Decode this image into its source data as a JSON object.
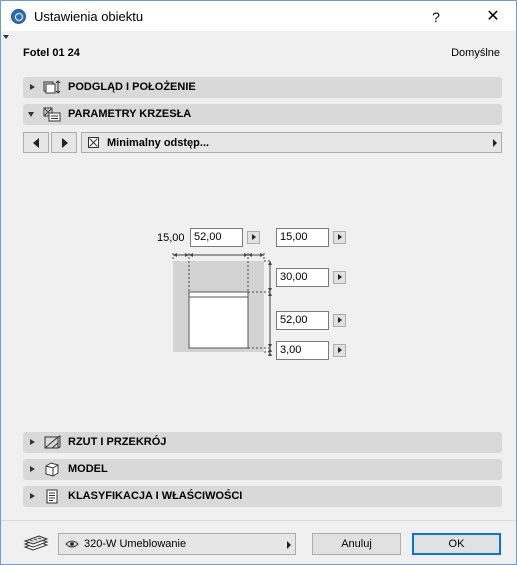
{
  "window": {
    "title": "Ustawienia obiektu",
    "help_label": "?",
    "close_label": "✕"
  },
  "header": {
    "object_name": "Fotel 01 24",
    "default_label": "Domyślne"
  },
  "sections": {
    "preview": {
      "label": "PODGLĄD I POŁOŻENIE",
      "icon": "preview-position-icon",
      "expanded": false
    },
    "chair_params": {
      "label": "PARAMETRY KRZESŁA",
      "icon": "chair-parameters-icon",
      "expanded": true
    },
    "plan_section": {
      "label": "RZUT I PRZEKRÓJ",
      "icon": "plan-section-icon",
      "expanded": false
    },
    "model": {
      "label": "MODEL",
      "icon": "model-cube-icon",
      "expanded": false
    },
    "classification": {
      "label": "KLASYFIKACJA I WŁAŚCIWOŚCI",
      "icon": "classification-icon",
      "expanded": false
    }
  },
  "param_nav": {
    "page_label": "Minimalny odstęp..."
  },
  "clearance": {
    "left_offset": "15,00",
    "width": "52,00",
    "right_offset": "15,00",
    "back": "30,00",
    "depth": "52,00",
    "front": "3,00"
  },
  "footer": {
    "layer_label": "320-W Umeblowanie",
    "cancel_label": "Anuluj",
    "ok_label": "OK"
  },
  "colors": {
    "accent": "#0078d7",
    "section_bar": "#d9d9d9",
    "clearance_fill": "#d3d3d3"
  }
}
